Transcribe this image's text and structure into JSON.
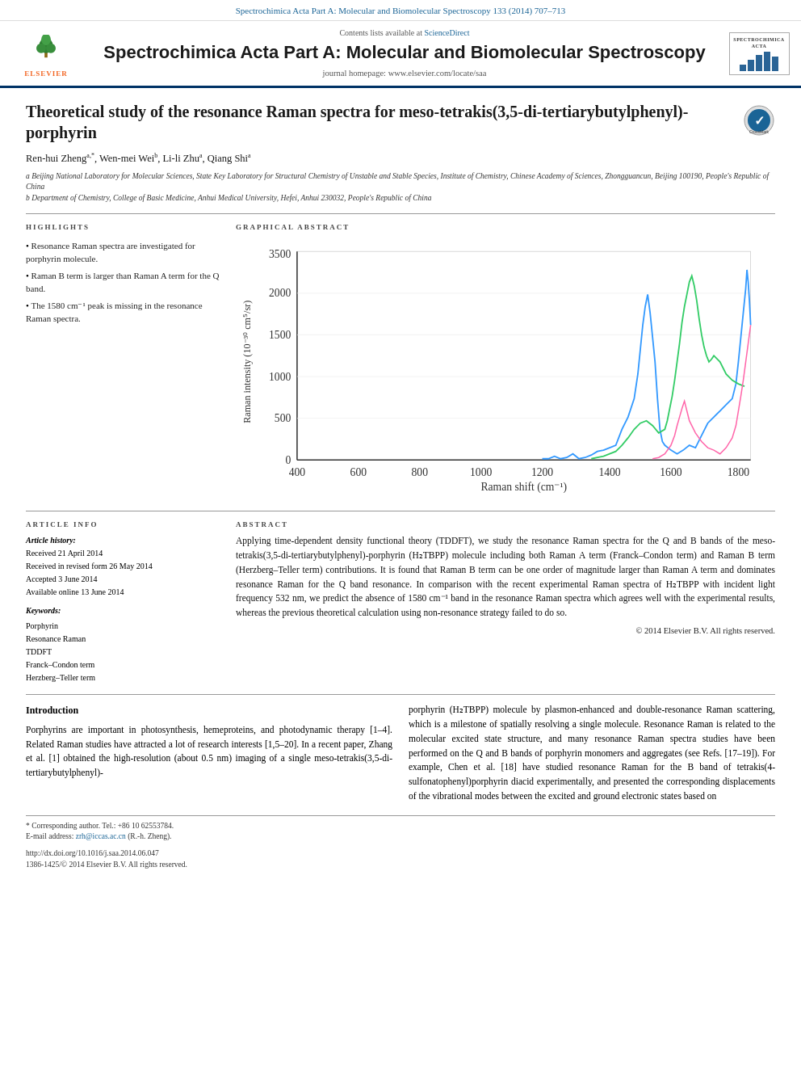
{
  "topBanner": {
    "text": "Spectrochimica Acta Part A: Molecular and Biomolecular Spectroscopy 133 (2014) 707–713"
  },
  "journalHeader": {
    "contentsLine": "Contents lists available at",
    "scienceDirectLink": "ScienceDirect",
    "journalTitle": "Spectrochimica Acta Part A: Molecular and Biomolecular Spectroscopy",
    "homepageLine": "journal homepage: www.elsevier.com/locate/saa",
    "rightLogoTitle": "SPECTROCHIMICA ACTA",
    "elsevier": "ELSEVIER"
  },
  "article": {
    "title": "Theoretical study of the resonance Raman spectra for meso-tetrakis(3,5-di-tertiarybutylphenyl)-porphyrin",
    "authors": "Ren-hui Zheng a,*, Wen-mei Wei b, Li-li Zhu a, Qiang Shi a",
    "affiliation_a": "a Beijing National Laboratory for Molecular Sciences, State Key Laboratory for Structural Chemistry of Unstable and Stable Species, Institute of Chemistry, Chinese Academy of Sciences, Zhongguancun, Beijing 100190, People's Republic of China",
    "affiliation_b": "b Department of Chemistry, College of Basic Medicine, Anhui Medical University, Hefei, Anhui 230032, People's Republic of China"
  },
  "highlights": {
    "label": "HIGHLIGHTS",
    "items": [
      "Resonance Raman spectra are investigated for porphyrin molecule.",
      "Raman B term is larger than Raman A term for the Q band.",
      "The 1580 cm⁻¹ peak is missing in the resonance Raman spectra."
    ]
  },
  "graphicalAbstract": {
    "label": "GRAPHICAL ABSTRACT",
    "chart": {
      "xLabel": "Raman shift (cm⁻¹)",
      "yLabel": "Raman intensity (10⁻³⁰ cm⁵/sr)",
      "xMin": 400,
      "xMax": 1800,
      "yMin": 0,
      "yMax": 3500
    }
  },
  "articleInfo": {
    "label": "ARTICLE INFO",
    "historyLabel": "Article history:",
    "received": "Received 21 April 2014",
    "revised": "Received in revised form 26 May 2014",
    "accepted": "Accepted 3 June 2014",
    "online": "Available online 13 June 2014",
    "keywordsLabel": "Keywords:",
    "keywords": [
      "Porphyrin",
      "Resonance Raman",
      "TDDFT",
      "Franck–Condon term",
      "Herzberg–Teller term"
    ]
  },
  "abstract": {
    "label": "ABSTRACT",
    "text": "Applying time-dependent density functional theory (TDDFT), we study the resonance Raman spectra for the Q and B bands of the meso-tetrakis(3,5-di-tertiarybutylphenyl)-porphyrin (H₂TBPP) molecule including both Raman A term (Franck–Condon term) and Raman B term (Herzberg–Teller term) contributions. It is found that Raman B term can be one order of magnitude larger than Raman A term and dominates resonance Raman for the Q band resonance. In comparison with the recent experimental Raman spectra of H₂TBPP with incident light frequency 532 nm, we predict the absence of 1580 cm⁻¹ band in the resonance Raman spectra which agrees well with the experimental results, whereas the previous theoretical calculation using non-resonance strategy failed to do so.",
    "copyright": "© 2014 Elsevier B.V. All rights reserved."
  },
  "introduction": {
    "heading": "Introduction",
    "leftCol": "Porphyrins are important in photosynthesis, hemeproteins, and photodynamic therapy [1–4]. Related Raman studies have attracted a lot of research interests [1,5–20]. In a recent paper, Zhang et al. [1] obtained the high-resolution (about 0.5 nm) imaging of a single meso-tetrakis(3,5-di-tertiarybutylphenyl)-",
    "rightCol": "porphyrin (H₂TBPP) molecule by plasmon-enhanced and double-resonance Raman scattering, which is a milestone of spatially resolving a single molecule. Resonance Raman is related to the molecular excited state structure, and many resonance Raman spectra studies have been performed on the Q and B bands of porphyrin monomers and aggregates (see Refs. [17–19]). For example, Chen et al. [18] have studied resonance Raman for the B band of tetrakis(4-sulfonatophenyl)porphyrin diacid experimentally, and presented the corresponding displacements of the vibrational modes between the excited and ground electronic states based on"
  },
  "footnote": {
    "corresponding": "* Corresponding author. Tel.: +86 10 62553784.",
    "email": "E-mail address: zrh@iccas.ac.cn (R.-h. Zheng)."
  },
  "doi": {
    "link": "http://dx.doi.org/10.1016/j.saa.2014.06.047",
    "rights": "1386-1425/© 2014 Elsevier B.V. All rights reserved."
  }
}
